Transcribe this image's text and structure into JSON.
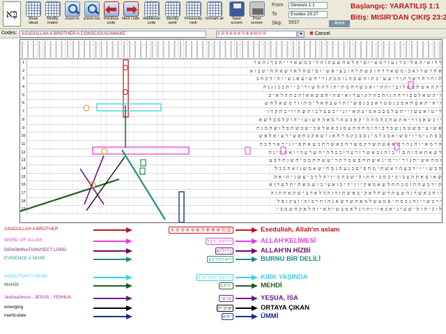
{
  "toolbar": {
    "logo_glyph": "בְּא",
    "buttons": [
      {
        "label": "Show nikud",
        "icon": "grid-icon"
      },
      {
        "label": "Modify matrix",
        "icon": "matrix-icon"
      },
      {
        "label": "Zoom-in",
        "icon": "zoom-in-icon"
      },
      {
        "label": "Zoom-out",
        "icon": "zoom-out-icon"
      },
      {
        "label": "Previous code",
        "icon": "arrow-left-icon"
      },
      {
        "label": "Next code",
        "icon": "arrow-right-icon"
      },
      {
        "label": "Additional code",
        "icon": "grid-icon"
      },
      {
        "label": "Identify word",
        "icon": "grid-icon"
      },
      {
        "label": "Previously rank",
        "icon": "grid-icon"
      },
      {
        "label": "Unmark all",
        "icon": "grid-icon"
      },
      {
        "label": "Save screen",
        "icon": "disk-icon"
      },
      {
        "label": "Print screen",
        "icon": "printer-icon"
      }
    ],
    "from_label": "From",
    "from_value": "Genesis 1:1",
    "to_label": "To",
    "to_value": "Exodus 23:27",
    "skip_label": "Skip",
    "skip_value": "5937",
    "area_label": "Area",
    "title_start": "Başlangıç: YARATILIŞ 1:1",
    "title_end": "Bitiş: MISIR'DAN ÇIKIŞ 23:27"
  },
  "codes": {
    "label": "Codes:",
    "value": "ASADULLAH A BROTHER A CONSCIOUS/AWAKE",
    "chain_text": "①②③④⑤⑥⑦⑧⑨⑩⑪⑫",
    "dropdown_glyph": "▾",
    "cancel_label": "Cancel",
    "cancel_glyph": "✖"
  },
  "matrix": {
    "row_numbers": [
      "1",
      "2",
      "3",
      "4",
      "5",
      "6",
      "7",
      "8",
      "9",
      "10",
      "11",
      "12",
      "13",
      "14",
      "15",
      "16",
      "17",
      "18",
      "19"
    ],
    "rows": [
      "ךלואיהאליבדנעורמאיוםיהלאהשעהוהליכמשארייתבךנהאר",
      "אחרשרואכומשאררהוקשתרהובציאשיוםיםהלארשאהחישבוא",
      "תוחרחרשרתוריעשיבתוהשמהנומבקוריחשועאגשיוהידקחב",
      "יקהאשתהאלוביותתיואבשדחמתיתורההשוריכייתבכוגנה",
      "ויהשאלסבורחהגוהכהלקוערואיפהיחפשאאוהבתהלאיכ",
      "ויאיתאטחאמבנסטראבבנפשיותרעבהאלימהוורמשאלהש",
      "ריטואטעזייתעלמבבאמיבקאיונייבעצלבותשחוויבתקדו",
      "יוכשאבוריאתשהכהמההיקאבטהרמאהחשועויהוקלמכרשא",
      "אשועיםשטמןשבדבוהזמתההעסנכאאלאכישבשתפלושהמנח",
      "בסתגימיויסשואבבלמינסבכקמרחאנישאקבחפשירעואלאש",
      "הרמאיוהנהרשאאטתשדקמשרהבאשרתבשאתפיוניךארדבת",
      "רשאתאהזהםויבוהנבאשרורעדובכלהיחשרעהיואתמינה",
      "ומהאשיתנוריוימינאשתחפשמלתריעשתתמביתשנחלבע",
      "הבשויוידבעהראשתימחפיסבגעהנמחישאמשנואהבבל",
      "שאוםאתהעבוכיכמביחתוהישבהמיויהלךביעשגיתואה",
      "תידבעהתומכתחלשאמאקיווידיבואעיבושמאתיתלעדוא",
      "יוחבאשרוהשעתרשחלאקיבאשתורוהךלארבישתאחתוה",
      "ירבשויוהנבמתיאמעשלמאהשדשאנהותרבוכיוצקנפל",
      "לוכיהוהישעוניאבאויותרגלאמבשיתאיוהלאקחשמבי"
    ]
  },
  "legend": {
    "items": [
      {
        "english": "ASADULLAH A BROTHER",
        "english_color": "#c0141a",
        "hebrew": "①②③④⑤⑥⑦⑧⑨⑩⑪⑫",
        "turkish": "Esedullah, Allah'ın aslanı",
        "color": "#c0141a"
      },
      {
        "english": "WORD OF ALLAH",
        "english_color": "#e040e0",
        "hebrew": "הלאה רבד",
        "turkish": "ALLAH'KELİMESİ",
        "color": "#e040e0"
      },
      {
        "english": "DENOMINATION/SECT LORD",
        "english_color": "#7a1b6e",
        "hebrew": "ןרזלוא",
        "turkish": "ALLAH'IN HİZBİ",
        "color": "#6a0d6a"
      },
      {
        "english": "EVIDENCE A NOSE",
        "english_color": "#2a8f8f",
        "hebrew": "ףאהתדבע",
        "turkish": "BURNU BİR DELİLİ",
        "color": "#1a8f7f"
      },
      {
        "english": "AGED FORTY YEAR",
        "english_color": "#3fd6e6",
        "hebrew": "הנשםיעבראןב",
        "turkish": "KIRK YAŞINDA",
        "color": "#32d4e4"
      },
      {
        "english": "MAHDI",
        "english_color": "#1f5a1f",
        "hebrew": "ידהמ",
        "turkish": "MEHDİ",
        "color": "#1f5a1f"
      },
      {
        "english": "JeshuaJesus , JESUS , YESHUA",
        "english_color": "#9b1b9b",
        "hebrew": "עושי",
        "turkish": "YEŞUA, İSA",
        "color": "#6a1a8a"
      },
      {
        "english": "emerging",
        "english_color": "#000000",
        "hebrew": "אוביה",
        "turkish": "ORTAYA ÇIKAN",
        "color": "#000000"
      },
      {
        "english": "inarticulate",
        "english_color": "#000000",
        "hebrew": "ימא",
        "turkish": "ÜMMİ",
        "color": "#1a2a8f"
      }
    ]
  }
}
